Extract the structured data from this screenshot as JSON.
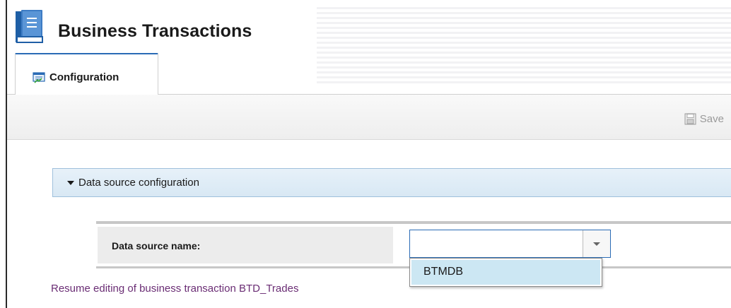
{
  "app": {
    "title": "Business Transactions",
    "icon": "book-icon"
  },
  "tabs": [
    {
      "label": "Configuration",
      "icon": "configuration-icon",
      "active": true
    }
  ],
  "toolbar": {
    "save_label": "Save",
    "save_icon": "floppy-disk-icon",
    "save_enabled": false
  },
  "section": {
    "label": "Data source configuration",
    "expanded": true
  },
  "form": {
    "data_source_label": "Data source name:",
    "data_source_value": "",
    "dropdown_open": true,
    "options": [
      "BTMDB"
    ],
    "highlighted_option": "BTMDB"
  },
  "resume_link": "Resume editing of business transaction BTD_Trades",
  "colors": {
    "accent": "#2a6bb5",
    "section_header_bg": "#d8e8f4",
    "option_highlight": "#cce7f3",
    "link": "#6a2d74"
  }
}
